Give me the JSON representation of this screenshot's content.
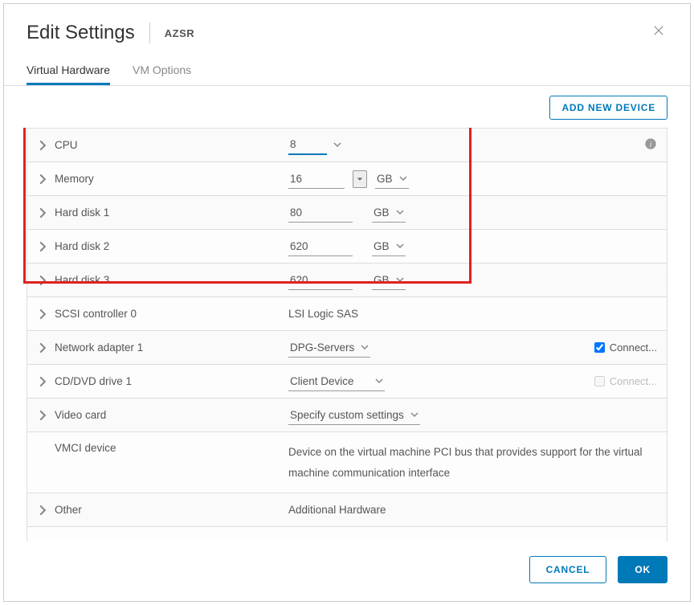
{
  "header": {
    "title": "Edit Settings",
    "vm_name": "AZSR"
  },
  "tabs": {
    "hardware": "Virtual Hardware",
    "options": "VM Options"
  },
  "toolbar": {
    "add_device": "ADD NEW DEVICE"
  },
  "rows": {
    "cpu": {
      "label": "CPU",
      "value": "8"
    },
    "memory": {
      "label": "Memory",
      "value": "16",
      "unit": "GB"
    },
    "hd1": {
      "label": "Hard disk 1",
      "value": "80",
      "unit": "GB"
    },
    "hd2": {
      "label": "Hard disk 2",
      "value": "620",
      "unit": "GB"
    },
    "hd3": {
      "label": "Hard disk 3",
      "value": "620",
      "unit": "GB"
    },
    "scsi": {
      "label": "SCSI controller 0",
      "value": "LSI Logic SAS"
    },
    "net": {
      "label": "Network adapter 1",
      "value": "DPG-Servers",
      "connect": "Connect..."
    },
    "cd": {
      "label": "CD/DVD drive 1",
      "value": "Client Device",
      "connect": "Connect..."
    },
    "video": {
      "label": "Video card",
      "value": "Specify custom settings"
    },
    "vmci": {
      "label": "VMCI device",
      "value": "Device on the virtual machine PCI bus that provides support for the virtual machine communication interface"
    },
    "other": {
      "label": "Other",
      "value": "Additional Hardware"
    }
  },
  "footer": {
    "cancel": "CANCEL",
    "ok": "OK"
  }
}
